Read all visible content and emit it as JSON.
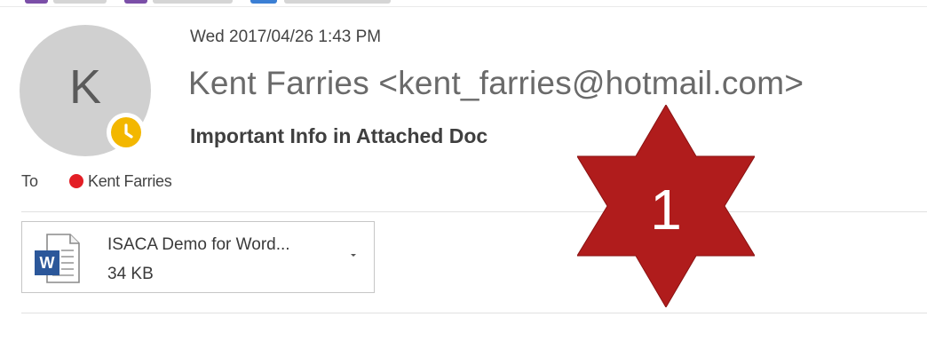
{
  "message": {
    "date": "Wed 2017/04/26 1:43 PM",
    "sender": "Kent Farries <kent_farries@hotmail.com>",
    "subject": "Important Info in Attached Doc",
    "avatar_initial": "K",
    "presence_color": "#f3b700",
    "avatar_color": "#d0d0d0"
  },
  "recipients": {
    "label": "To",
    "items": [
      {
        "name": "Kent Farries",
        "status_color": "#e31e25"
      }
    ]
  },
  "attachment": {
    "name": "ISACA Demo for Word...",
    "size": "34 KB",
    "icon": "word-document-icon",
    "icon_color": "#2b579a"
  },
  "annotation": {
    "label": "1",
    "shape": "six-pointed-star",
    "color": "#b01c1c"
  }
}
